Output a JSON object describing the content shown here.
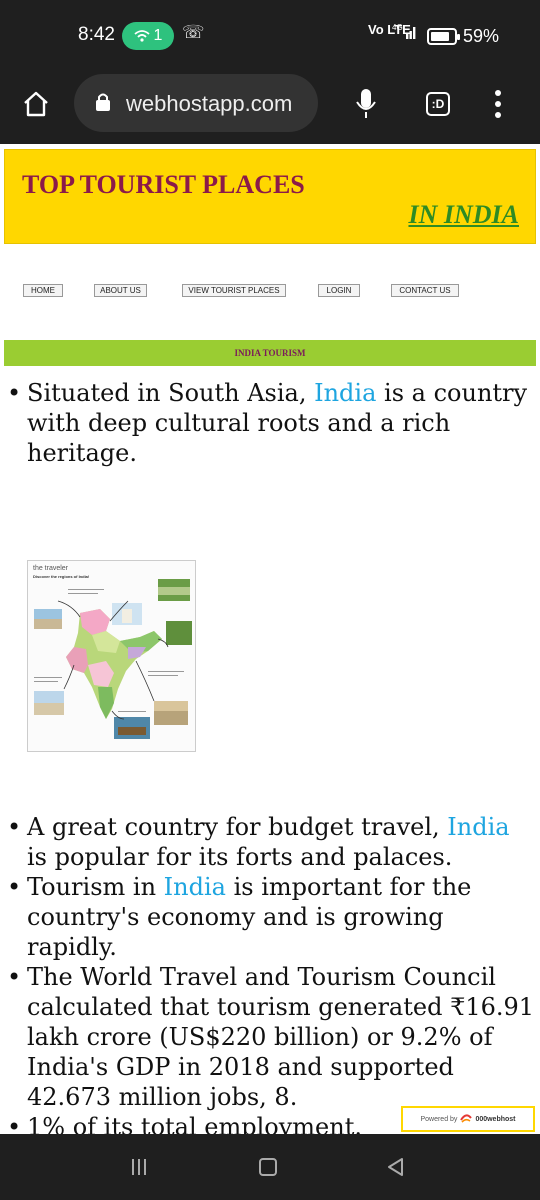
{
  "status": {
    "time": "8:42",
    "wifi_count": "1",
    "network": "Vo LTE",
    "signal": "4G",
    "battery": "59%"
  },
  "browser": {
    "url": "webhostapp.com",
    "tab_label": ":D"
  },
  "banner": {
    "title": "TOP TOURIST PLACES",
    "subtitle": "IN INDIA"
  },
  "nav": {
    "home": "HOME",
    "about": "ABOUT US",
    "places": "VIEW TOURIST PLACES",
    "login": "LOGIN",
    "contact": "CONTACT US"
  },
  "marquee": "INDIA TOURISM",
  "content": {
    "p1_a": "Situated in South Asia, ",
    "p1_link": "India",
    "p1_b": " is a country with deep cultural roots and a rich heritage.",
    "p2_a": "A great country for budget travel, ",
    "p2_link": "India",
    "p2_b": " is popular for its forts and palaces.",
    "p3_a": "Tourism in ",
    "p3_link": "India",
    "p3_b": " is important for the country's economy and is growing rapidly.",
    "p4": "The World Travel and Tourism Council calculated that tourism generated ₹16.91 lakh crore (US$220 billion) or 9.2% of India's GDP in 2018 and supported 42.673 million jobs, 8.",
    "p5": "1% of its total employment."
  },
  "image": {
    "brand": "the traveler",
    "heading": "Discover the regions of India!"
  },
  "powered": {
    "prefix": "Powered by",
    "brand": "000webhost"
  }
}
